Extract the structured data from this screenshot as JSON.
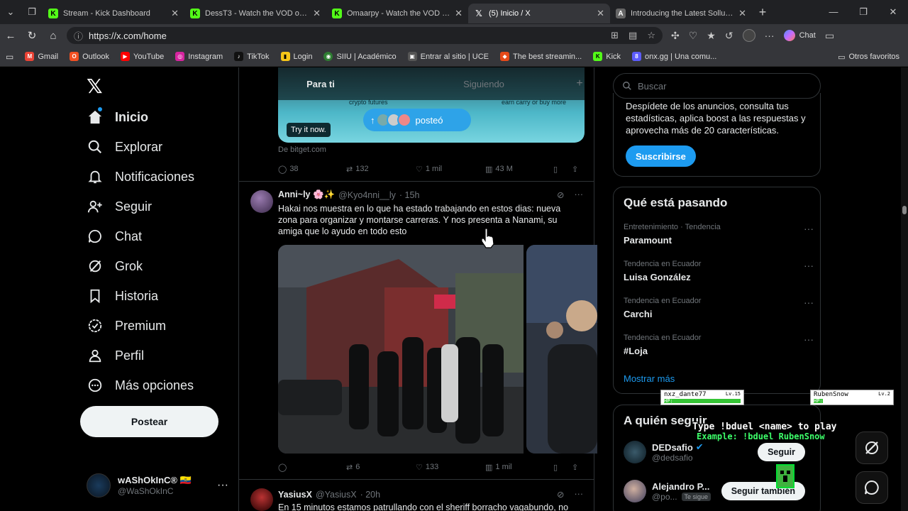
{
  "browser": {
    "tabs": [
      {
        "title": "Stream - Kick Dashboard",
        "icon": "kick-icon",
        "active": false
      },
      {
        "title": "DessT3 - Watch the VOD on Kick",
        "icon": "kick-icon",
        "active": false
      },
      {
        "title": "Omaarpy - Watch the VOD on Kick",
        "icon": "kick-icon",
        "active": false
      },
      {
        "title": "(5) Inicio / X",
        "icon": "x-icon",
        "active": true
      },
      {
        "title": "Introducing the Latest Sollumz Up",
        "icon": "page-icon",
        "active": false
      }
    ],
    "url": "https://x.com/home",
    "chat_label": "Chat",
    "bookmarks": [
      {
        "label": "Gmail",
        "color": "#ea4335"
      },
      {
        "label": "Outlook",
        "color": "#f25022"
      },
      {
        "label": "YouTube",
        "color": "#ff0000"
      },
      {
        "label": "Instagram",
        "color": "#d6249f"
      },
      {
        "label": "TikTok",
        "color": "#111111"
      },
      {
        "label": "Login",
        "color": "#f5c518"
      },
      {
        "label": "SIIU | Académico",
        "color": "#2e7d32"
      },
      {
        "label": "Entrar al sitio | UCE",
        "color": "#555555"
      },
      {
        "label": "The best streamin...",
        "color": "#e64a19"
      },
      {
        "label": "Kick",
        "color": "#53fc18"
      },
      {
        "label": "onx.gg | Una comu...",
        "color": "#5c5cff"
      }
    ],
    "other_bookmarks": "Otros favoritos"
  },
  "nav": {
    "items": [
      {
        "label": "Inicio",
        "icon": "home-icon",
        "bold": true
      },
      {
        "label": "Explorar",
        "icon": "search-icon",
        "bold": false
      },
      {
        "label": "Notificaciones",
        "icon": "bell-icon",
        "bold": false
      },
      {
        "label": "Seguir",
        "icon": "add-user-icon",
        "bold": false
      },
      {
        "label": "Chat",
        "icon": "chat-icon",
        "bold": false
      },
      {
        "label": "Grok",
        "icon": "grok-icon",
        "bold": false
      },
      {
        "label": "Historia",
        "icon": "bookmark-icon",
        "bold": false
      },
      {
        "label": "Premium",
        "icon": "verified-icon",
        "bold": false
      },
      {
        "label": "Perfil",
        "icon": "person-icon",
        "bold": false
      },
      {
        "label": "Más opciones",
        "icon": "more-icon",
        "bold": false
      }
    ],
    "post_label": "Postear",
    "profile": {
      "name": "wAShOkInC® 🇪🇨",
      "handle": "@WaShOkInC"
    }
  },
  "timeline": {
    "tabs": [
      "Para ti",
      "Siguiendo"
    ],
    "ad": {
      "text_left": "crypto futures",
      "text_right": "earn carry or buy more",
      "try_label": "Try it now.",
      "pill_label": "posteó",
      "from": "De bitget.com",
      "replies": "38",
      "reposts": "132",
      "likes": "1 mil",
      "views": "43 M"
    },
    "tweet1": {
      "name": "Anni~ly 🌸✨",
      "handle": "@Kyo4nni__ly",
      "time": "· 15h",
      "text": "Hakai nos muestra en lo que ha estado trabajando en estos dias: nueva zona para organizar y montarse carreras. Y nos presenta a Nanami, su amiga que lo ayudo en todo esto",
      "replies": "",
      "reposts": "6",
      "likes": "133",
      "views": "1 mil"
    },
    "tweet2": {
      "name": "YasiusX",
      "handle": "@YasiusX",
      "time": "· 20h",
      "text": "En 15 minutos estamos patrullando con el sheriff borracho vagabundo, no"
    }
  },
  "right": {
    "search_placeholder": "Buscar",
    "premium_text": "Despídete de los anuncios, consulta tus estadísticas, aplica boost a las respuestas y aprovecha más de 20 características.",
    "subscribe_label": "Suscribirse",
    "trends_title": "Qué está pasando",
    "trends": [
      {
        "category": "Entretenimiento · Tendencia",
        "name": "Paramount"
      },
      {
        "category": "Tendencia en Ecuador",
        "name": "Luisa González"
      },
      {
        "category": "Tendencia en Ecuador",
        "name": "Carchi"
      },
      {
        "category": "Tendencia en Ecuador",
        "name": "#Loja"
      }
    ],
    "show_more": "Mostrar más",
    "follow_title": "A quién seguir",
    "follow": [
      {
        "name": "DEDsafio",
        "handle": "@dedsafio",
        "button": "Seguir",
        "follows_you": ""
      },
      {
        "name": "Alejandro P...",
        "handle": "@po...",
        "button": "Seguir también",
        "follows_you": "Te sigue"
      }
    ]
  },
  "overlay": {
    "player1": {
      "name": "nxz_dante77",
      "level": "Lv.15",
      "hp": 1.0
    },
    "player2": {
      "name": "RubenSnow",
      "level": "Lv.2",
      "hp": 0.12
    },
    "hp_label": "HP:",
    "line1": "Type !bduel <name> to play",
    "line2": "Example: !bduel RubenSnow"
  }
}
